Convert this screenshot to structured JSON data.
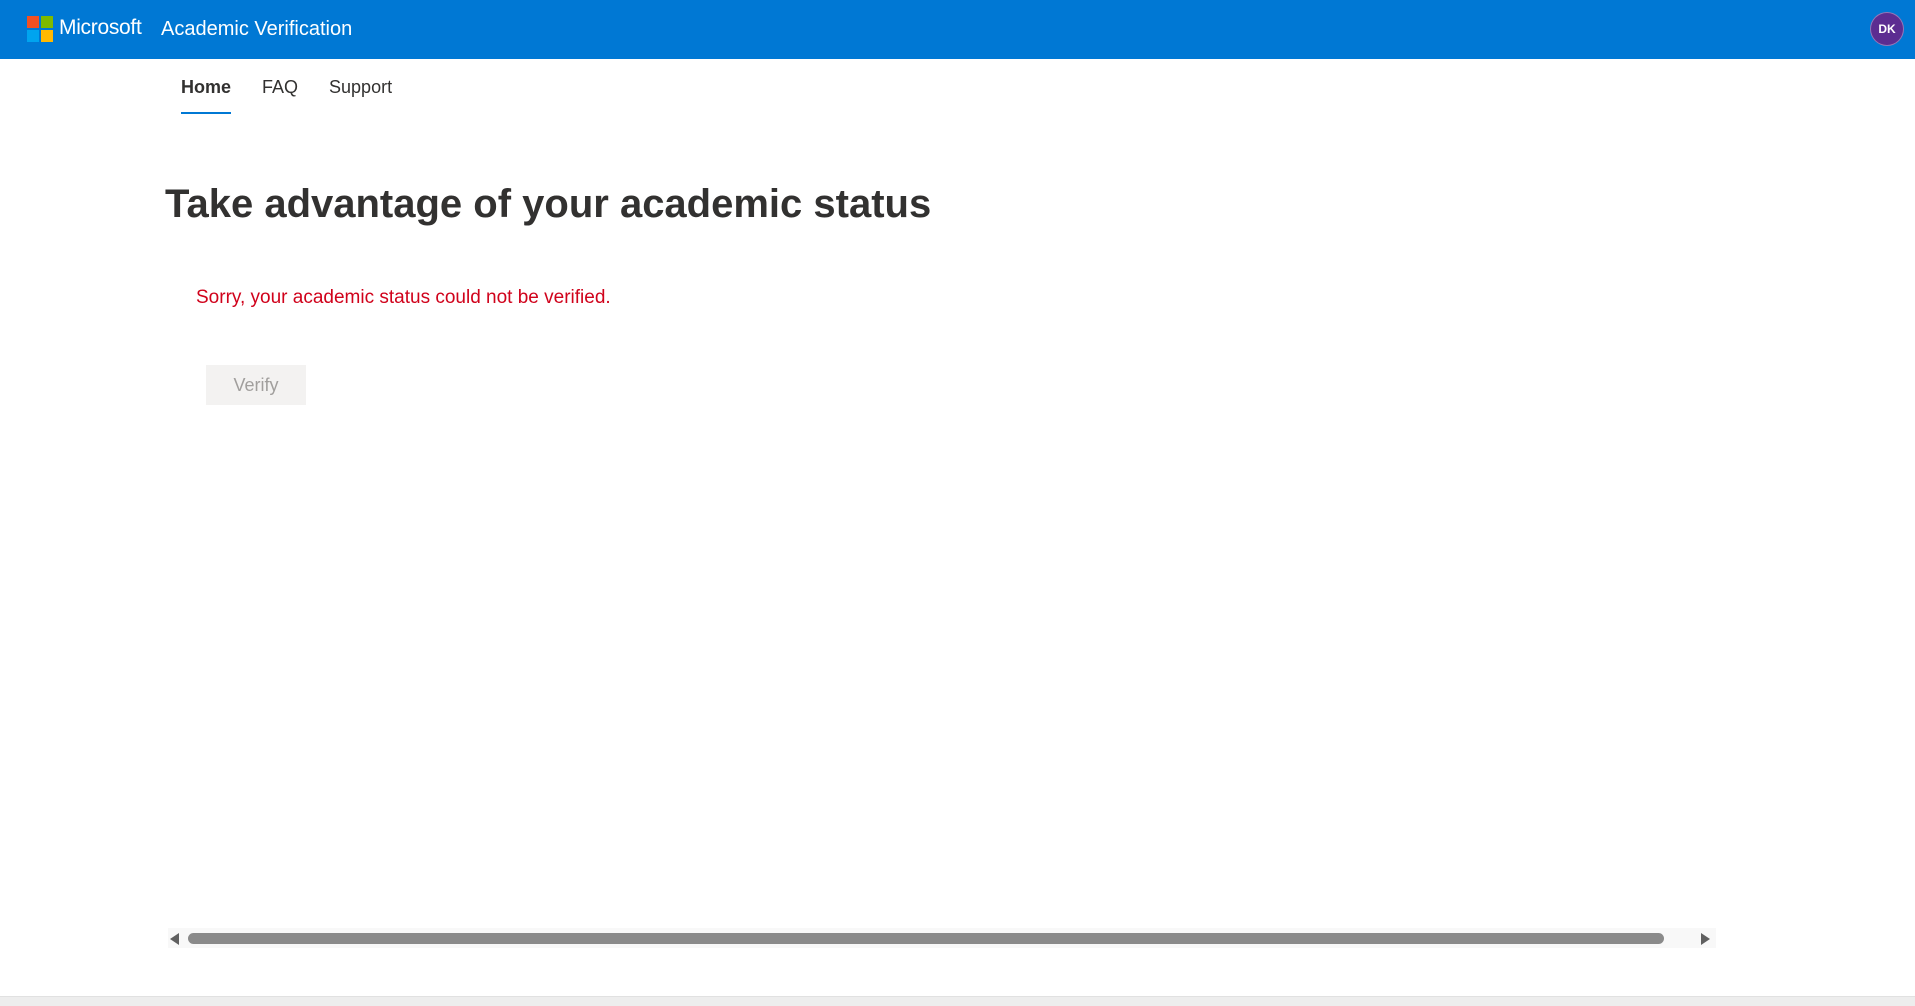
{
  "header": {
    "brand": "Microsoft",
    "app_title": "Academic Verification",
    "avatar_initials": "DK",
    "logo_colors": [
      "#f25022",
      "#7fba00",
      "#00a4ef",
      "#ffb900"
    ]
  },
  "nav": {
    "items": [
      {
        "label": "Home",
        "active": true
      },
      {
        "label": "FAQ",
        "active": false
      },
      {
        "label": "Support",
        "active": false
      }
    ]
  },
  "main": {
    "title": "Take advantage of your academic status",
    "error_message": "Sorry, your academic status could not be verified.",
    "verify_label": "Verify",
    "verify_disabled": true
  },
  "colors": {
    "accent": "#0078d4",
    "error": "#d0021b",
    "avatar": "#5c2d91"
  }
}
